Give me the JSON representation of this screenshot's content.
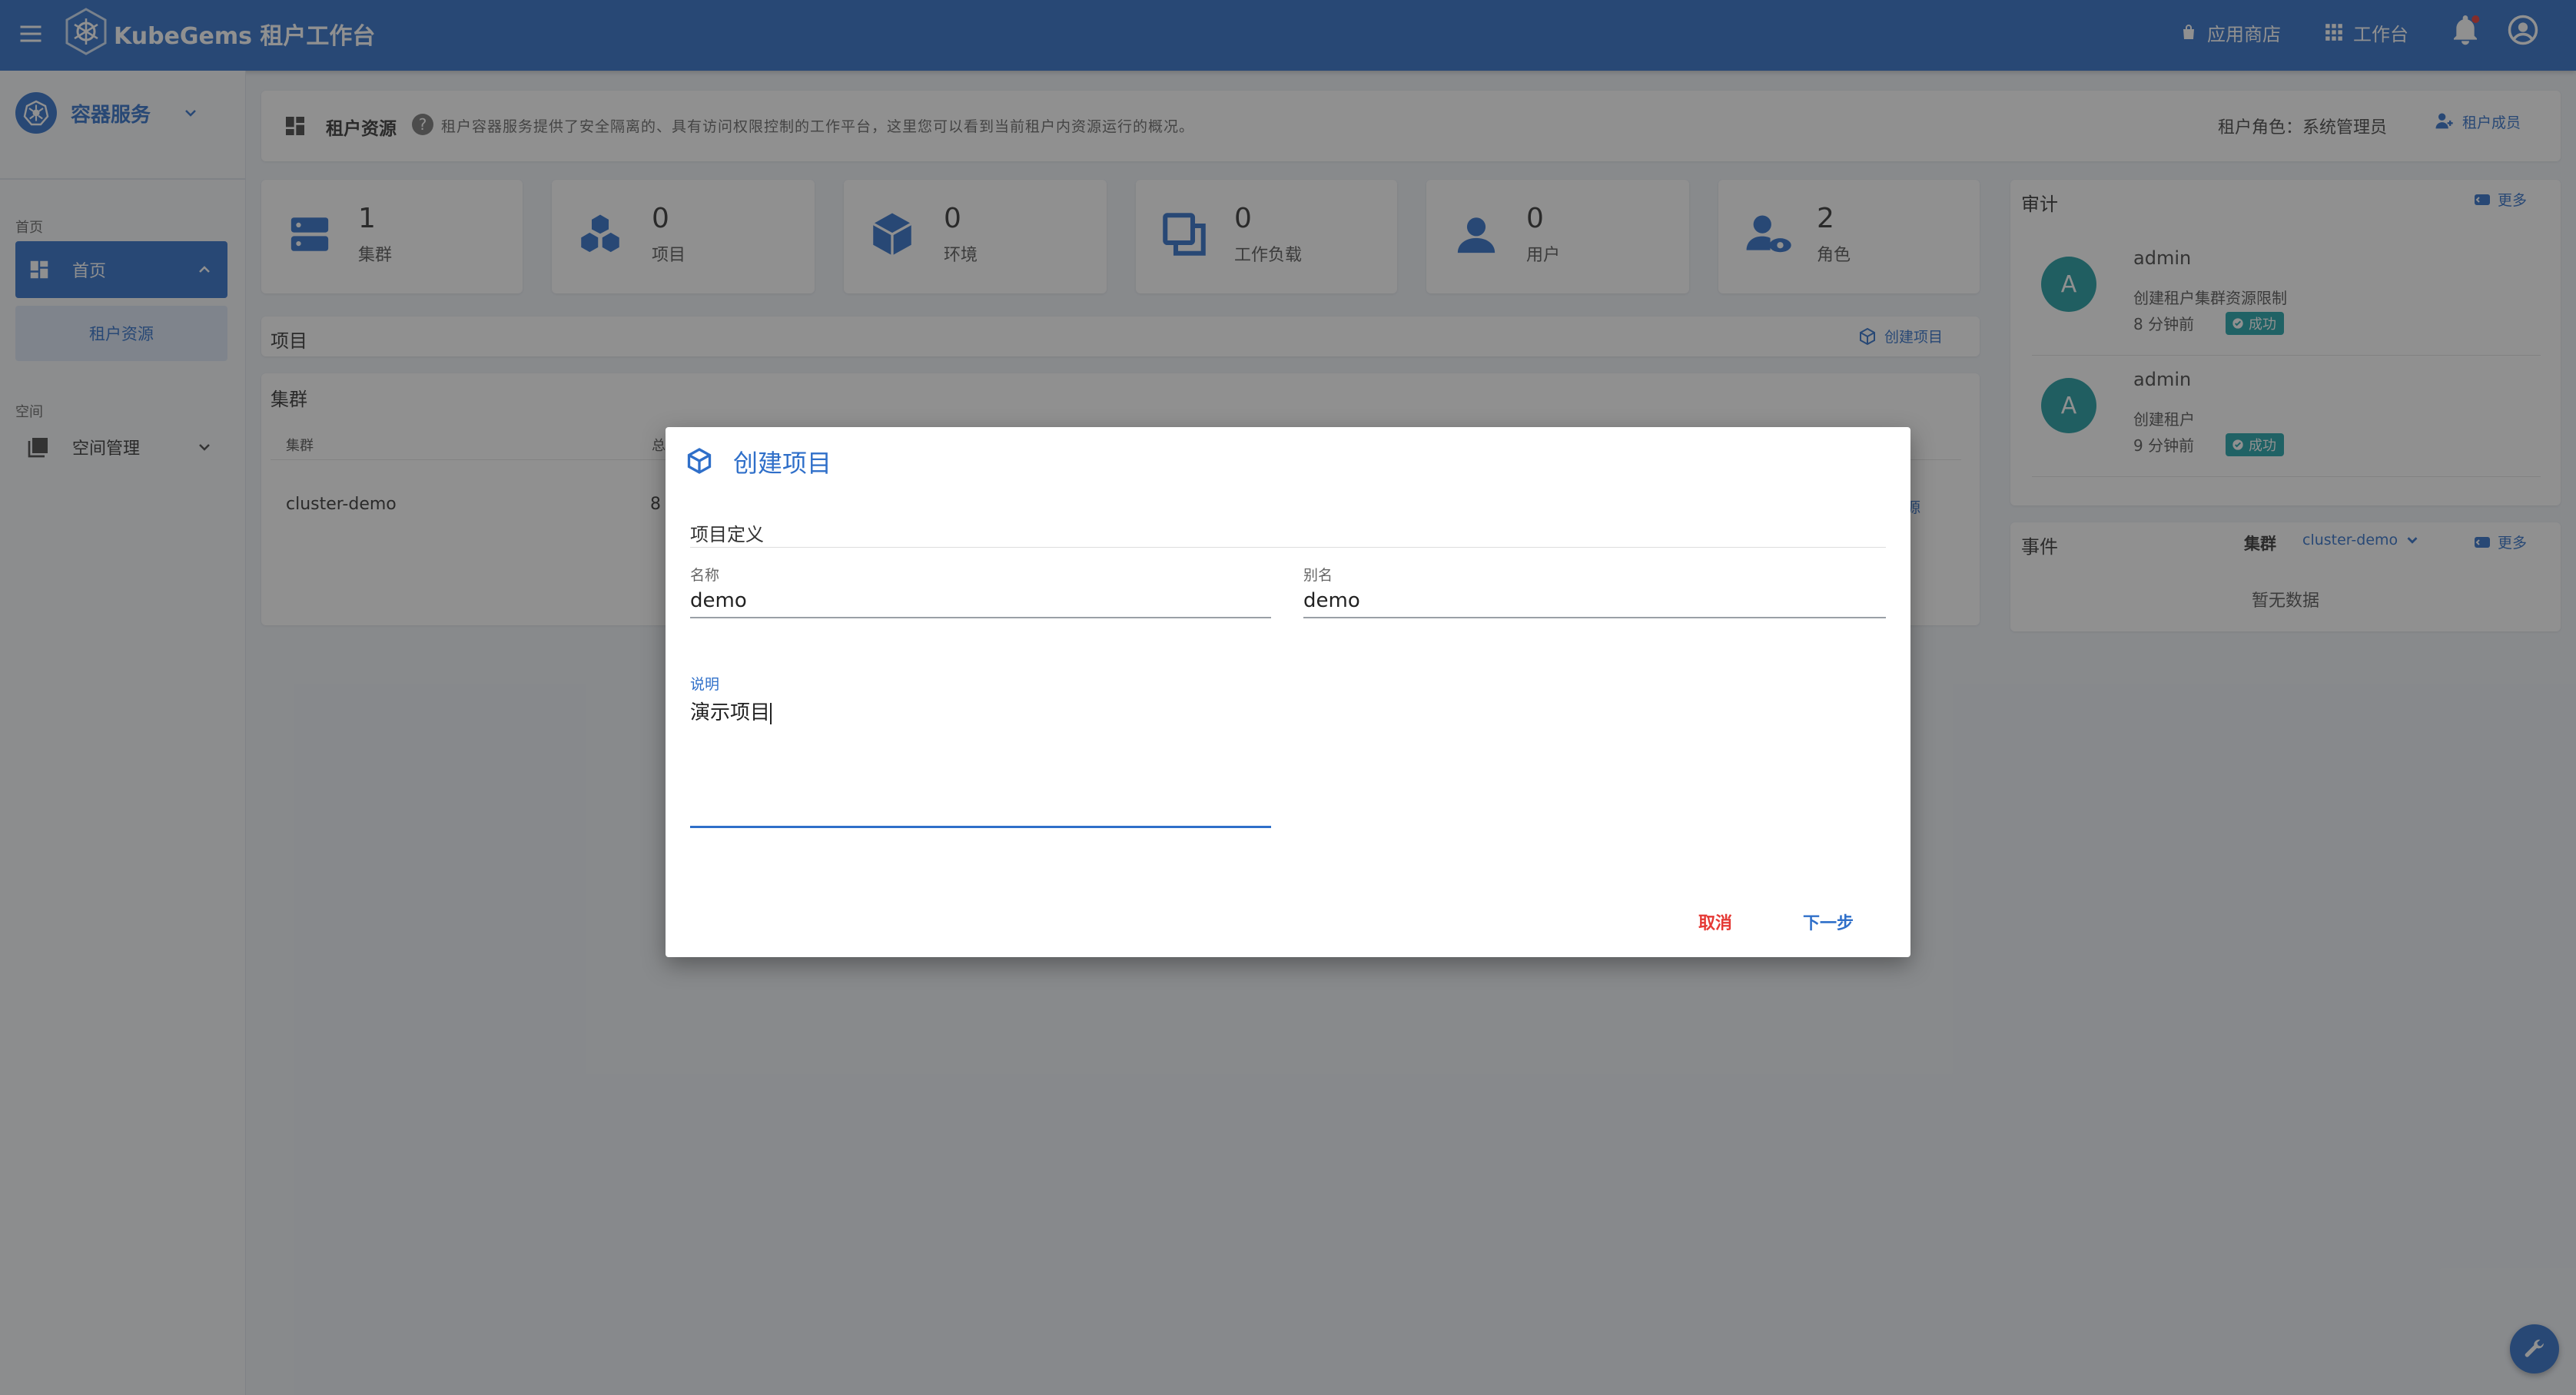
{
  "topbar": {
    "brand": "KubeGems 租户工作台",
    "app_store": "应用商店",
    "workbench": "工作台"
  },
  "sidebar": {
    "service_title": "容器服务",
    "sections": [
      {
        "label": "首页"
      },
      {
        "label": "空间"
      }
    ],
    "home_item": "首页",
    "home_sub_item": "租户资源",
    "space_item": "空间管理"
  },
  "page_header": {
    "title": "租户资源",
    "description": "租户容器服务提供了安全隔离的、具有访问权限控制的工作平台，这里您可以看到当前租户内资源运行的概况。",
    "role_text": "租户角色：系统管理员",
    "members_button": "租户成员"
  },
  "stats": [
    {
      "value": "1",
      "label": "集群",
      "icon": "cluster-icon"
    },
    {
      "value": "0",
      "label": "项目",
      "icon": "project-icon"
    },
    {
      "value": "0",
      "label": "环境",
      "icon": "environment-icon"
    },
    {
      "value": "0",
      "label": "工作负载",
      "icon": "workload-icon"
    },
    {
      "value": "0",
      "label": "用户",
      "icon": "user-icon"
    },
    {
      "value": "2",
      "label": "角色",
      "icon": "role-icon"
    }
  ],
  "projects_panel": {
    "title": "项目",
    "create_button": "创建项目"
  },
  "clusters_panel": {
    "title": "集群",
    "columns": [
      "集群",
      "总"
    ],
    "rows": [
      {
        "name": "cluster-demo",
        "total": "8",
        "tail": "源"
      }
    ]
  },
  "audit_panel": {
    "title": "审计",
    "more": "更多",
    "items": [
      {
        "avatar": "A",
        "user": "admin",
        "action": "创建租户集群资源限制",
        "time": "8 分钟前",
        "status": "成功"
      },
      {
        "avatar": "A",
        "user": "admin",
        "action": "创建租户",
        "time": "9 分钟前",
        "status": "成功"
      }
    ]
  },
  "events_panel": {
    "title": "事件",
    "cluster_label": "集群",
    "cluster_value": "cluster-demo",
    "more": "更多",
    "empty": "暂无数据"
  },
  "dialog": {
    "title": "创建项目",
    "section": "项目定义",
    "name_label": "名称",
    "name_value": "demo",
    "alias_label": "别名",
    "alias_value": "demo",
    "desc_label": "说明",
    "desc_value": "演示项目",
    "cancel": "取消",
    "next": "下一步"
  },
  "colors": {
    "primary": "#2f6fc9",
    "badge": "#1fa2a8",
    "cancel": "#e53935",
    "avatar": "#1e9aa1"
  }
}
